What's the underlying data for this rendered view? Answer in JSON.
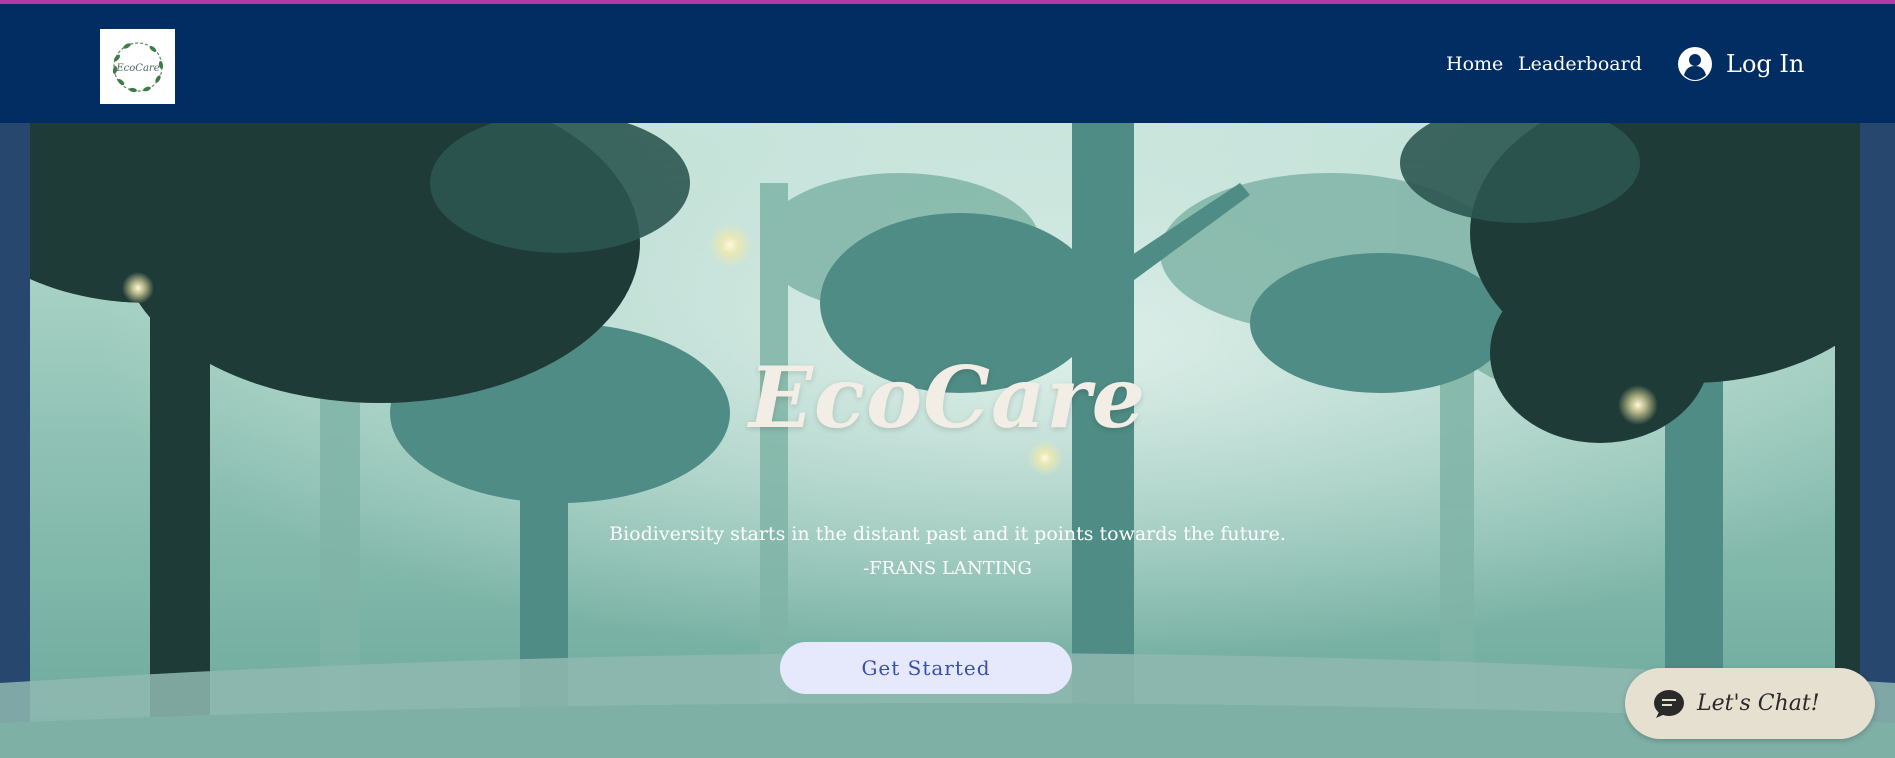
{
  "header": {
    "logo_text": "EcoCare",
    "nav": {
      "home_label": "Home",
      "leaderboard_label": "Leaderboard"
    },
    "login_label": "Log In",
    "login_icon": "user-avatar-icon",
    "colors": {
      "accent_line": "#b13aa6",
      "background": "#012d63"
    }
  },
  "hero": {
    "title": "EcoCare",
    "quote": "Biodiversity starts in the distant past and it points towards the future.",
    "author": "-FRANS LANTING",
    "cta_label": "Get Started",
    "background": "forest-illustration"
  },
  "chat": {
    "label": "Let's Chat!",
    "icon": "chat-bubble-icon"
  }
}
